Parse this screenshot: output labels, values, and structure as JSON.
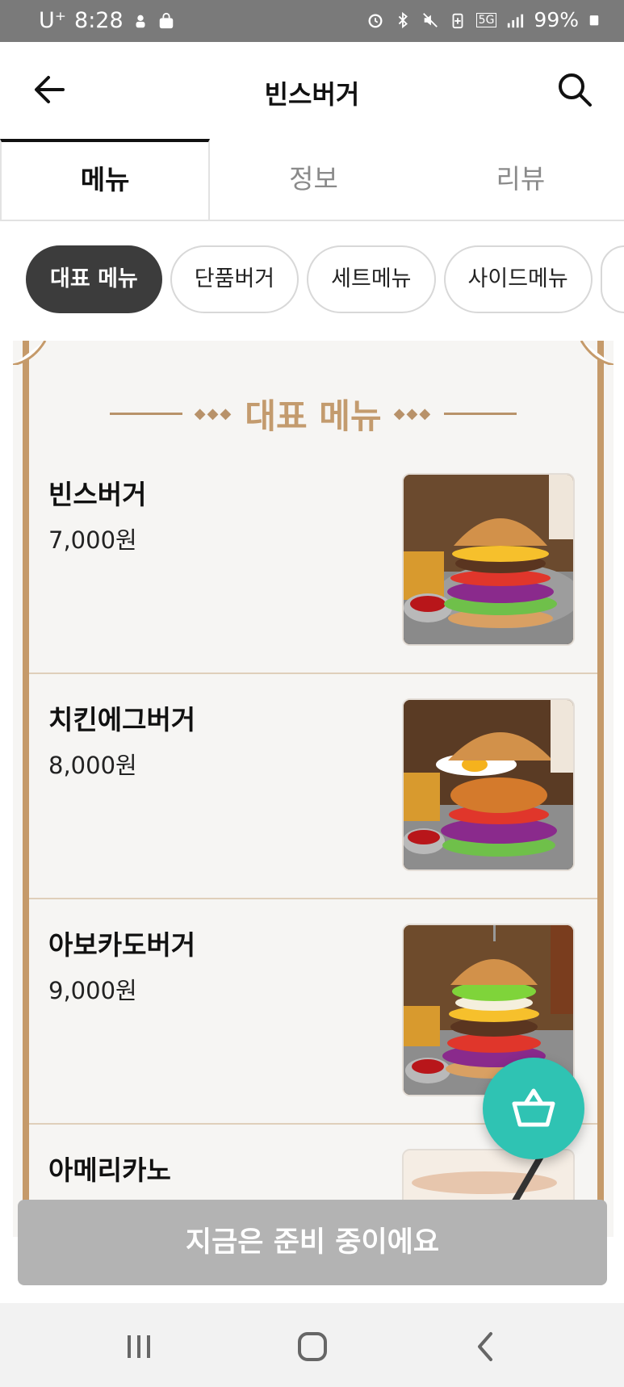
{
  "status_bar": {
    "carrier": "U⁺",
    "time": "8:28",
    "battery": "99%",
    "network": "5G"
  },
  "app_bar": {
    "title": "빈스버거",
    "back_icon": "arrow-left-icon",
    "search_icon": "search-icon"
  },
  "tabs": [
    {
      "label": "메뉴",
      "active": true
    },
    {
      "label": "정보",
      "active": false
    },
    {
      "label": "리뷰",
      "active": false
    }
  ],
  "categories": [
    {
      "label": "대표 메뉴",
      "active": true
    },
    {
      "label": "단품버거",
      "active": false
    },
    {
      "label": "세트메뉴",
      "active": false
    },
    {
      "label": "사이드메뉴",
      "active": false
    }
  ],
  "board": {
    "heading": "대표 메뉴",
    "items": [
      {
        "name": "빈스버거",
        "price": "7,000원"
      },
      {
        "name": "치킨에그버거",
        "price": "8,000원"
      },
      {
        "name": "아보카도버거",
        "price": "9,000원"
      },
      {
        "name": "아메리카노",
        "price": ""
      }
    ]
  },
  "cart_icon": "shopping-basket-icon",
  "cta": {
    "label": "지금은 준비 중이에요"
  },
  "colors": {
    "accent_teal": "#2fc3b3",
    "frame_gold": "#c59a6a",
    "chip_active": "#3c3c3c",
    "cta_disabled": "#b3b3b3"
  }
}
